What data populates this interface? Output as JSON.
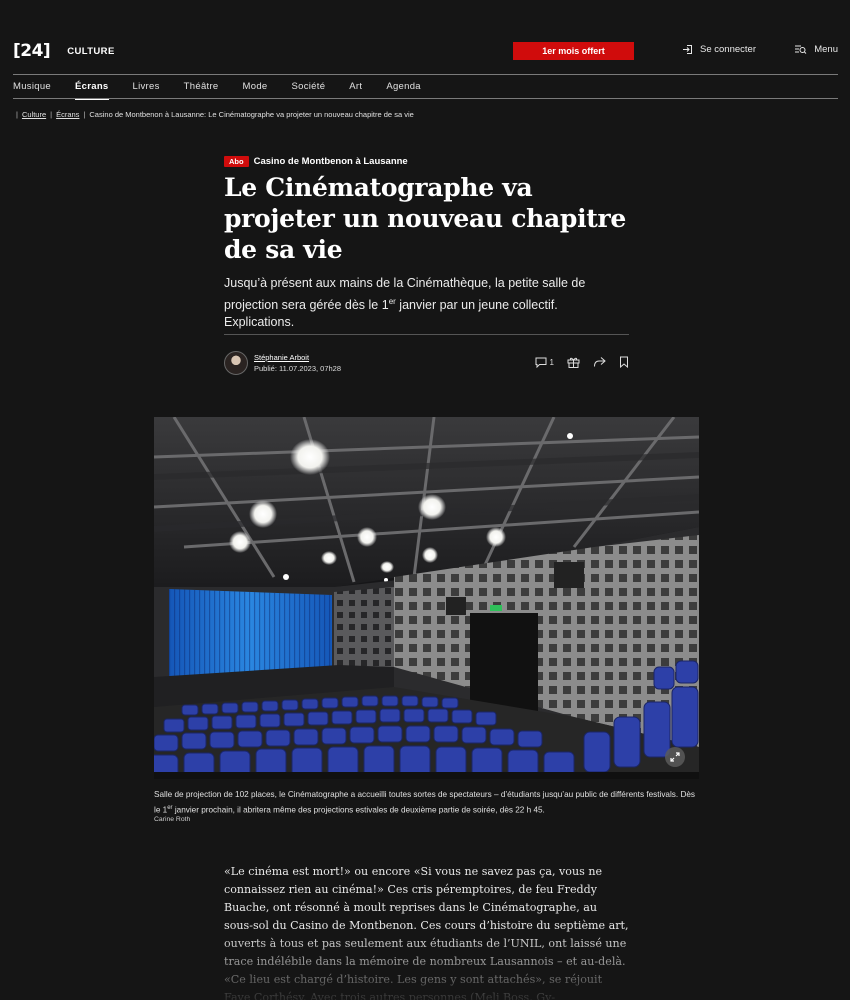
{
  "header": {
    "logo": "[24]",
    "section": "CULTURE",
    "offer_label": "1er mois offert",
    "login_label": "Se connecter",
    "menu_label": "Menu"
  },
  "nav": {
    "items": [
      {
        "label": "Musique"
      },
      {
        "label": "Écrans"
      },
      {
        "label": "Livres"
      },
      {
        "label": "Théâtre"
      },
      {
        "label": "Mode"
      },
      {
        "label": "Société"
      },
      {
        "label": "Art"
      },
      {
        "label": "Agenda"
      }
    ],
    "active": "Écrans"
  },
  "breadcrumb": {
    "items": [
      "Culture",
      "Écrans",
      "Casino de Montbenon à Lausanne: Le Cinématographe va projeter un nouveau chapitre de sa vie"
    ]
  },
  "article": {
    "badge": "Abo",
    "kicker": "Casino de Montbenon à Lausanne",
    "title": "Le Cinématographe va projeter un nouveau chapitre de sa vie",
    "lead_before": "Jusqu’à présent aux mains de la Cinémathèque, la petite salle de projection sera gérée dès le 1",
    "lead_sup": "er",
    "lead_after": " janvier par un jeune collectif. Explications.",
    "author": "Stéphanie Arboit",
    "published": "Publié: 11.07.2023, 07h28",
    "comment_count": "1"
  },
  "photo": {
    "caption_before": "Salle de projection de 102 places, le Cinématographe a accueilli toutes sortes de spectateurs – d’étudiants jusqu’au public de différents festivals. Dès le 1",
    "caption_sup": "er",
    "caption_after": " janvier prochain, il abritera même des projections estivales de deuxième partie de soirée, dès 22 h 45.",
    "credit": "Carine Roth"
  },
  "body": {
    "paragraph": "«Le cinéma est mort!» ou encore «Si vous ne savez pas ça, vous ne connaissez rien au cinéma!» Ces cris péremptoires, de feu Freddy Buache, ont résonné à moult reprises dans le Cinématographe, au sous-sol du Casino de Montbenon. Ces cours d’histoire du septième art, ouverts à tous et pas seulement aux étudiants de l’UNIL, ont laissé une trace indélébile dans la mémoire de nombreux Lausannois – et au-delà. «Ce lieu est chargé d’histoire. Les gens y sont attachés», se réjouit Faye Corthésy. Avec trois autres personnes (Meli Boss, Gy-"
  },
  "colors": {
    "background": "#151515",
    "accent_red": "#d00c0c",
    "seat_blue": "#2a3fa0",
    "screen_blue": "#1f6fd0"
  },
  "icons": [
    "login-icon",
    "menu-search-icon",
    "comment-icon",
    "gift-icon",
    "share-icon",
    "bookmark-icon",
    "expand-icon"
  ]
}
